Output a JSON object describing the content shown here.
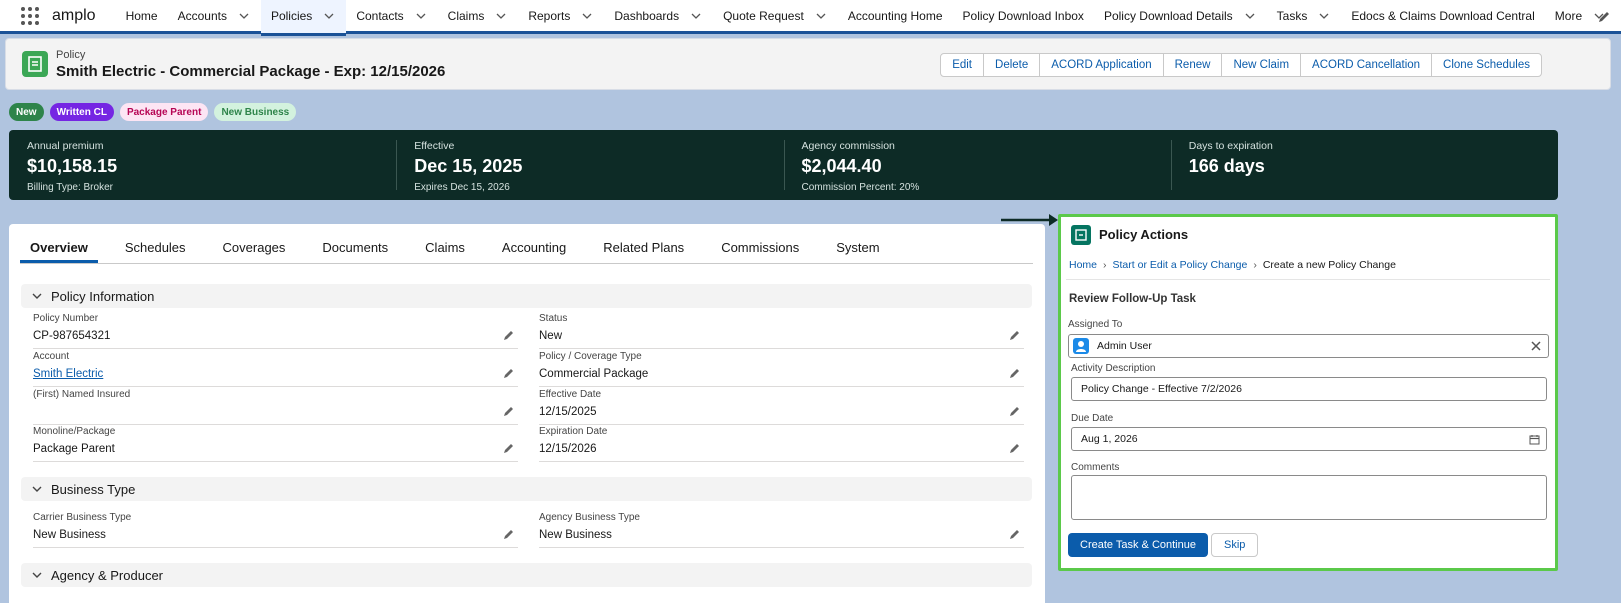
{
  "app": {
    "name": "amplo"
  },
  "nav": {
    "items": [
      {
        "label": "Home",
        "dropdown": false,
        "active": false
      },
      {
        "label": "Accounts",
        "dropdown": true,
        "active": false
      },
      {
        "label": "Policies",
        "dropdown": true,
        "active": true
      },
      {
        "label": "Contacts",
        "dropdown": true,
        "active": false
      },
      {
        "label": "Claims",
        "dropdown": true,
        "active": false
      },
      {
        "label": "Reports",
        "dropdown": true,
        "active": false
      },
      {
        "label": "Dashboards",
        "dropdown": true,
        "active": false
      },
      {
        "label": "Quote Request",
        "dropdown": true,
        "active": false
      },
      {
        "label": "Accounting Home",
        "dropdown": false,
        "active": false
      },
      {
        "label": "Policy Download Inbox",
        "dropdown": false,
        "active": false
      },
      {
        "label": "Policy Download Details",
        "dropdown": true,
        "active": false
      },
      {
        "label": "Tasks",
        "dropdown": true,
        "active": false
      },
      {
        "label": "Edocs & Claims Download Central",
        "dropdown": false,
        "active": false
      },
      {
        "label": "More",
        "dropdown": true,
        "active": false
      }
    ]
  },
  "header": {
    "object_type": "Policy",
    "title": "Smith Electric - Commercial Package - Exp: 12/15/2026",
    "buttons": [
      "Edit",
      "Delete",
      "ACORD Application",
      "Renew",
      "New Claim",
      "ACORD Cancellation",
      "Clone Schedules"
    ]
  },
  "pills": [
    {
      "label": "New",
      "bg": "#2e844a",
      "fg": "#ffffff"
    },
    {
      "label": "Written CL",
      "bg": "#7526e3",
      "fg": "#ffffff"
    },
    {
      "label": "Package Parent",
      "bg": "#fde5f4",
      "fg": "#b60554"
    },
    {
      "label": "New Business",
      "bg": "#d3f2de",
      "fg": "#2e844a"
    }
  ],
  "metrics": [
    {
      "label": "Annual premium",
      "value": "$10,158.15",
      "sub": "Billing Type: Broker"
    },
    {
      "label": "Effective",
      "value": "Dec 15, 2025",
      "sub": "Expires Dec 15, 2026"
    },
    {
      "label": "Agency commission",
      "value": "$2,044.40",
      "sub": "Commission Percent: 20%"
    },
    {
      "label": "Days to expiration",
      "value": "166 days",
      "sub": ""
    }
  ],
  "tabs": [
    "Overview",
    "Schedules",
    "Coverages",
    "Documents",
    "Claims",
    "Accounting",
    "Related Plans",
    "Commissions",
    "System"
  ],
  "sections": {
    "policy_information": {
      "title": "Policy Information",
      "fields": {
        "policy_number": {
          "label": "Policy Number",
          "value": "CP-987654321"
        },
        "status": {
          "label": "Status",
          "value": "New"
        },
        "account": {
          "label": "Account",
          "value": "Smith Electric"
        },
        "coverage_type": {
          "label": "Policy / Coverage Type",
          "value": "Commercial Package"
        },
        "named_insured": {
          "label": "(First) Named Insured",
          "value": ""
        },
        "effective_date": {
          "label": "Effective Date",
          "value": "12/15/2025"
        },
        "monoline": {
          "label": "Monoline/Package",
          "value": "Package Parent"
        },
        "expiration_date": {
          "label": "Expiration Date",
          "value": "12/15/2026"
        }
      }
    },
    "business_type": {
      "title": "Business Type",
      "fields": {
        "carrier_business_type": {
          "label": "Carrier Business Type",
          "value": "New Business"
        },
        "agency_business_type": {
          "label": "Agency Business Type",
          "value": "New Business"
        }
      }
    },
    "agency_producer": {
      "title": "Agency & Producer"
    }
  },
  "panel": {
    "title": "Policy Actions",
    "breadcrumbs": {
      "home": "Home",
      "start": "Start or Edit a Policy Change",
      "current": "Create a new Policy Change"
    },
    "subtitle": "Review Follow-Up Task",
    "assigned_to_label": "Assigned To",
    "assigned_to_value": "Admin User",
    "activity_label": "Activity Description",
    "activity_value": "Policy Change - Effective 7/2/2026",
    "due_date_label": "Due Date",
    "due_date_value": "Aug 1, 2026",
    "comments_label": "Comments",
    "create_button": "Create Task & Continue",
    "skip_button": "Skip"
  }
}
